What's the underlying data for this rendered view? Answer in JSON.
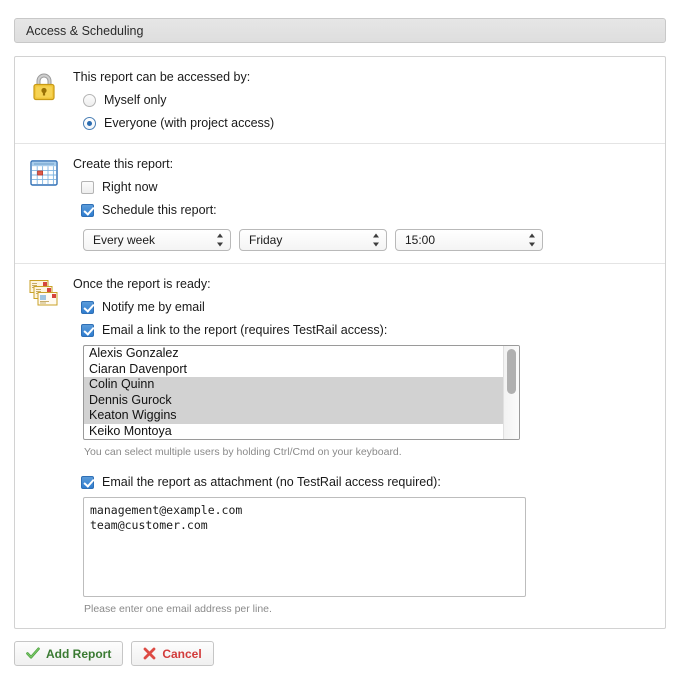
{
  "header": {
    "title": "Access & Scheduling"
  },
  "access": {
    "icon": "lock-icon",
    "title": "This report can be accessed by:",
    "options": [
      {
        "label": "Myself only",
        "checked": false
      },
      {
        "label": "Everyone (with project access)",
        "checked": true
      }
    ]
  },
  "create": {
    "icon": "calendar-icon",
    "title": "Create this report:",
    "options": [
      {
        "label": "Right now",
        "checked": false
      },
      {
        "label": "Schedule this report:",
        "checked": true
      }
    ],
    "schedule": {
      "frequency": {
        "value": "Every week",
        "name": "frequency-select"
      },
      "day": {
        "value": "Friday",
        "name": "day-select"
      },
      "time": {
        "value": "15:00",
        "name": "time-select"
      }
    }
  },
  "ready": {
    "icon": "emails-icon",
    "title": "Once the report is ready:",
    "notify": {
      "label": "Notify me by email",
      "checked": true
    },
    "email_link": {
      "label": "Email a link to the report (requires TestRail access):",
      "checked": true
    },
    "users": [
      {
        "name": "Alexis Gonzalez",
        "selected": false
      },
      {
        "name": "Ciaran Davenport",
        "selected": false
      },
      {
        "name": "Colin Quinn",
        "selected": true
      },
      {
        "name": "Dennis Gurock",
        "selected": true
      },
      {
        "name": "Keaton Wiggins",
        "selected": true
      },
      {
        "name": "Keiko Montoya",
        "selected": false
      }
    ],
    "users_hint": "You can select multiple users by holding Ctrl/Cmd on your keyboard.",
    "email_attachment": {
      "label": "Email the report as attachment (no TestRail access required):",
      "checked": true
    },
    "emails_value": "management@example.com\nteam@customer.com",
    "emails_hint": "Please enter one email address per line."
  },
  "footer": {
    "add_label": "Add Report",
    "cancel_label": "Cancel"
  },
  "colors": {
    "accent_blue": "#2f7dd0",
    "add_green": "#3a7a32",
    "cancel_red": "#d23b3b",
    "selection_gray": "#d2d2d2"
  }
}
